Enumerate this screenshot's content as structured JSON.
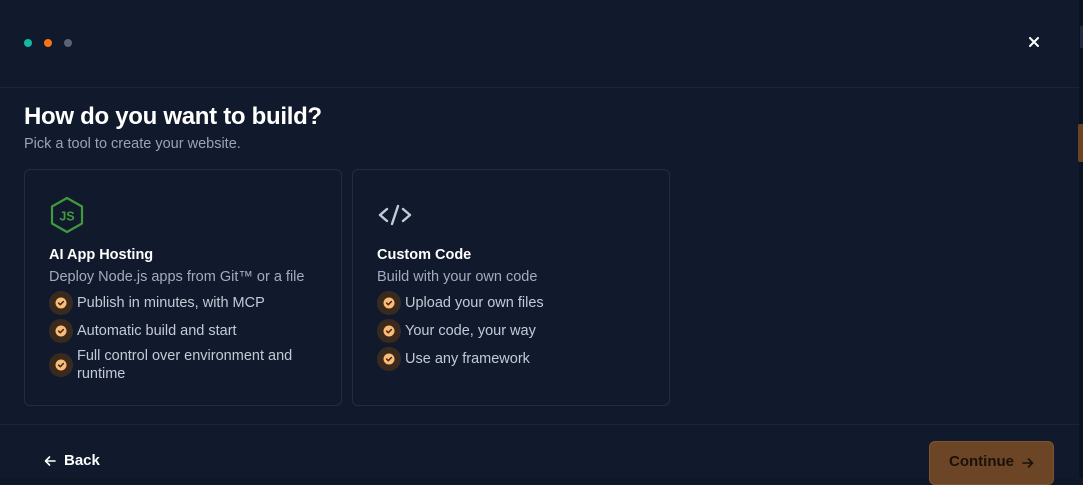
{
  "colors": {
    "step_active": "#14b8a6",
    "step_current": "#f97316",
    "step_inactive": "#5b6475",
    "accent": "#fdba74",
    "node_green": "#3f9a3f"
  },
  "steps": [
    {
      "state": "done"
    },
    {
      "state": "current"
    },
    {
      "state": "upcoming"
    }
  ],
  "header": {
    "close_icon": "close-icon"
  },
  "main": {
    "title": "How do you want to build?",
    "subtitle": "Pick a tool to create your website."
  },
  "options": [
    {
      "icon": "nodejs-icon",
      "title": "AI App Hosting",
      "description": "Deploy Node.js apps from Git™ or a file",
      "features": [
        "Publish in minutes, with MCP",
        "Automatic build and start",
        "Full control over environment and runtime"
      ]
    },
    {
      "icon": "code-icon",
      "title": "Custom Code",
      "description": "Build with your own code",
      "features": [
        "Upload your own files",
        "Your code, your way",
        "Use any framework"
      ]
    }
  ],
  "footer": {
    "back_label": "Back",
    "continue_label": "Continue"
  }
}
